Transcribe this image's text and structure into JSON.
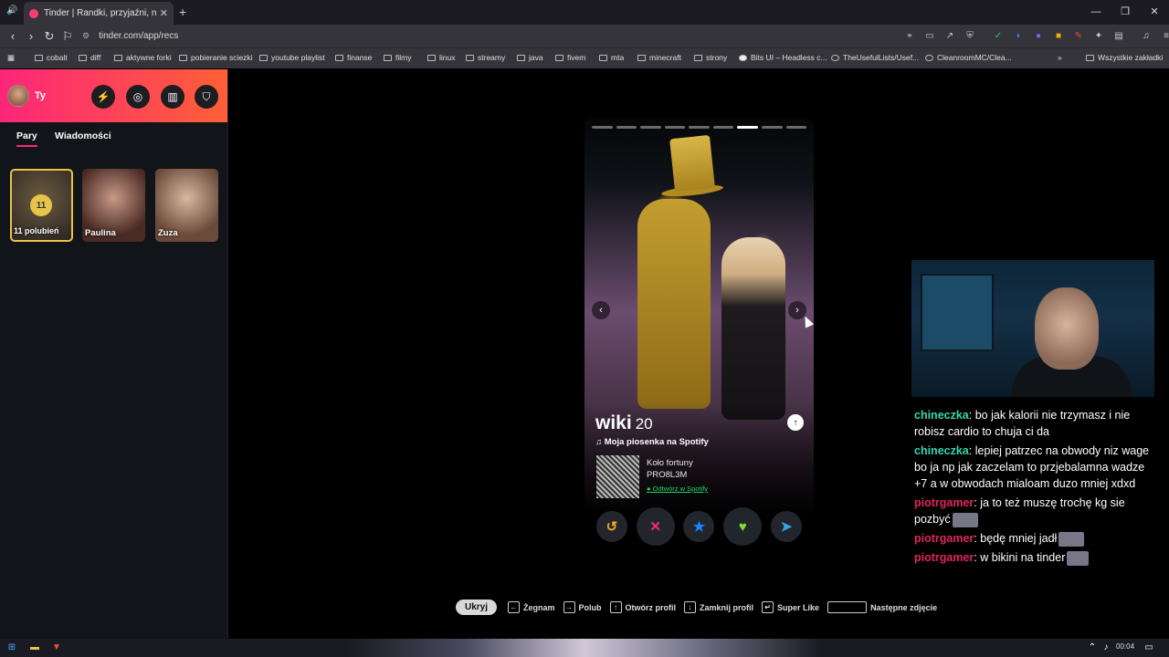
{
  "browser": {
    "tab_title": "Tinder | Randki, przyjaźni, nowe z",
    "url": "tinder.com/app/recs",
    "bookmarks": [
      "cobalt",
      "diff",
      "aktywne forki",
      "pobieranie sciezki",
      "youtube playlist",
      "finanse",
      "filmy",
      "linux",
      "streamy",
      "java",
      "fivem",
      "mta",
      "minecraft",
      "strony",
      "Bits UI – Headless c...",
      "TheUsefulLists/Usef...",
      "CleanroomMC/Clea...",
      "Wszystkie zakładki"
    ]
  },
  "sidebar": {
    "user_name": "Ty",
    "tabs": [
      "Pary",
      "Wiadomości"
    ],
    "likes_count": "11",
    "likes_label": "11 polubień",
    "matches": [
      "Paulina",
      "Zuza"
    ]
  },
  "profile": {
    "name": "wiki",
    "age": "20",
    "song_heading": "Moja piosenka na Spotify",
    "song_title": "Koło fortuny",
    "song_artist": "PRO8L3M",
    "spotify_link": "Odtwórz w Spotify",
    "photo_count": 9,
    "current_photo": 7,
    "colors": {
      "rewind": "#f5a623",
      "nope": "#fd267a",
      "super": "#1786ff",
      "like": "#7be22e",
      "boost": "#2ea8e6"
    }
  },
  "hints": {
    "hide": "Ukryj",
    "items": [
      "Żegnam",
      "Polub",
      "Otwórz profil",
      "Zamknij profil",
      "Super Like",
      "Następne zdjęcie"
    ]
  },
  "chat": [
    {
      "user": "chineczka",
      "color": "#33d6b0",
      "text": "bo jak kalorii nie trzymasz i nie robisz cardio to chuja ci da"
    },
    {
      "user": "chineczka",
      "color": "#33d6b0",
      "text": "lepiej patrzec na obwody niz wage bo ja np jak zaczelam to przjebalamna wadze +7 a w obwodach mialoam duzo mniej xdxd"
    },
    {
      "user": "piotrgamer",
      "color": "#e0245e",
      "text": "ja to też muszę trochę kg sie pozbyć"
    },
    {
      "user": "piotrgamer",
      "color": "#e0245e",
      "text": "będę mniej jadł"
    },
    {
      "user": "piotrgamer",
      "color": "#e0245e",
      "text": "w bikini na tinder"
    }
  ],
  "taskbar": {
    "time": "00:04"
  }
}
